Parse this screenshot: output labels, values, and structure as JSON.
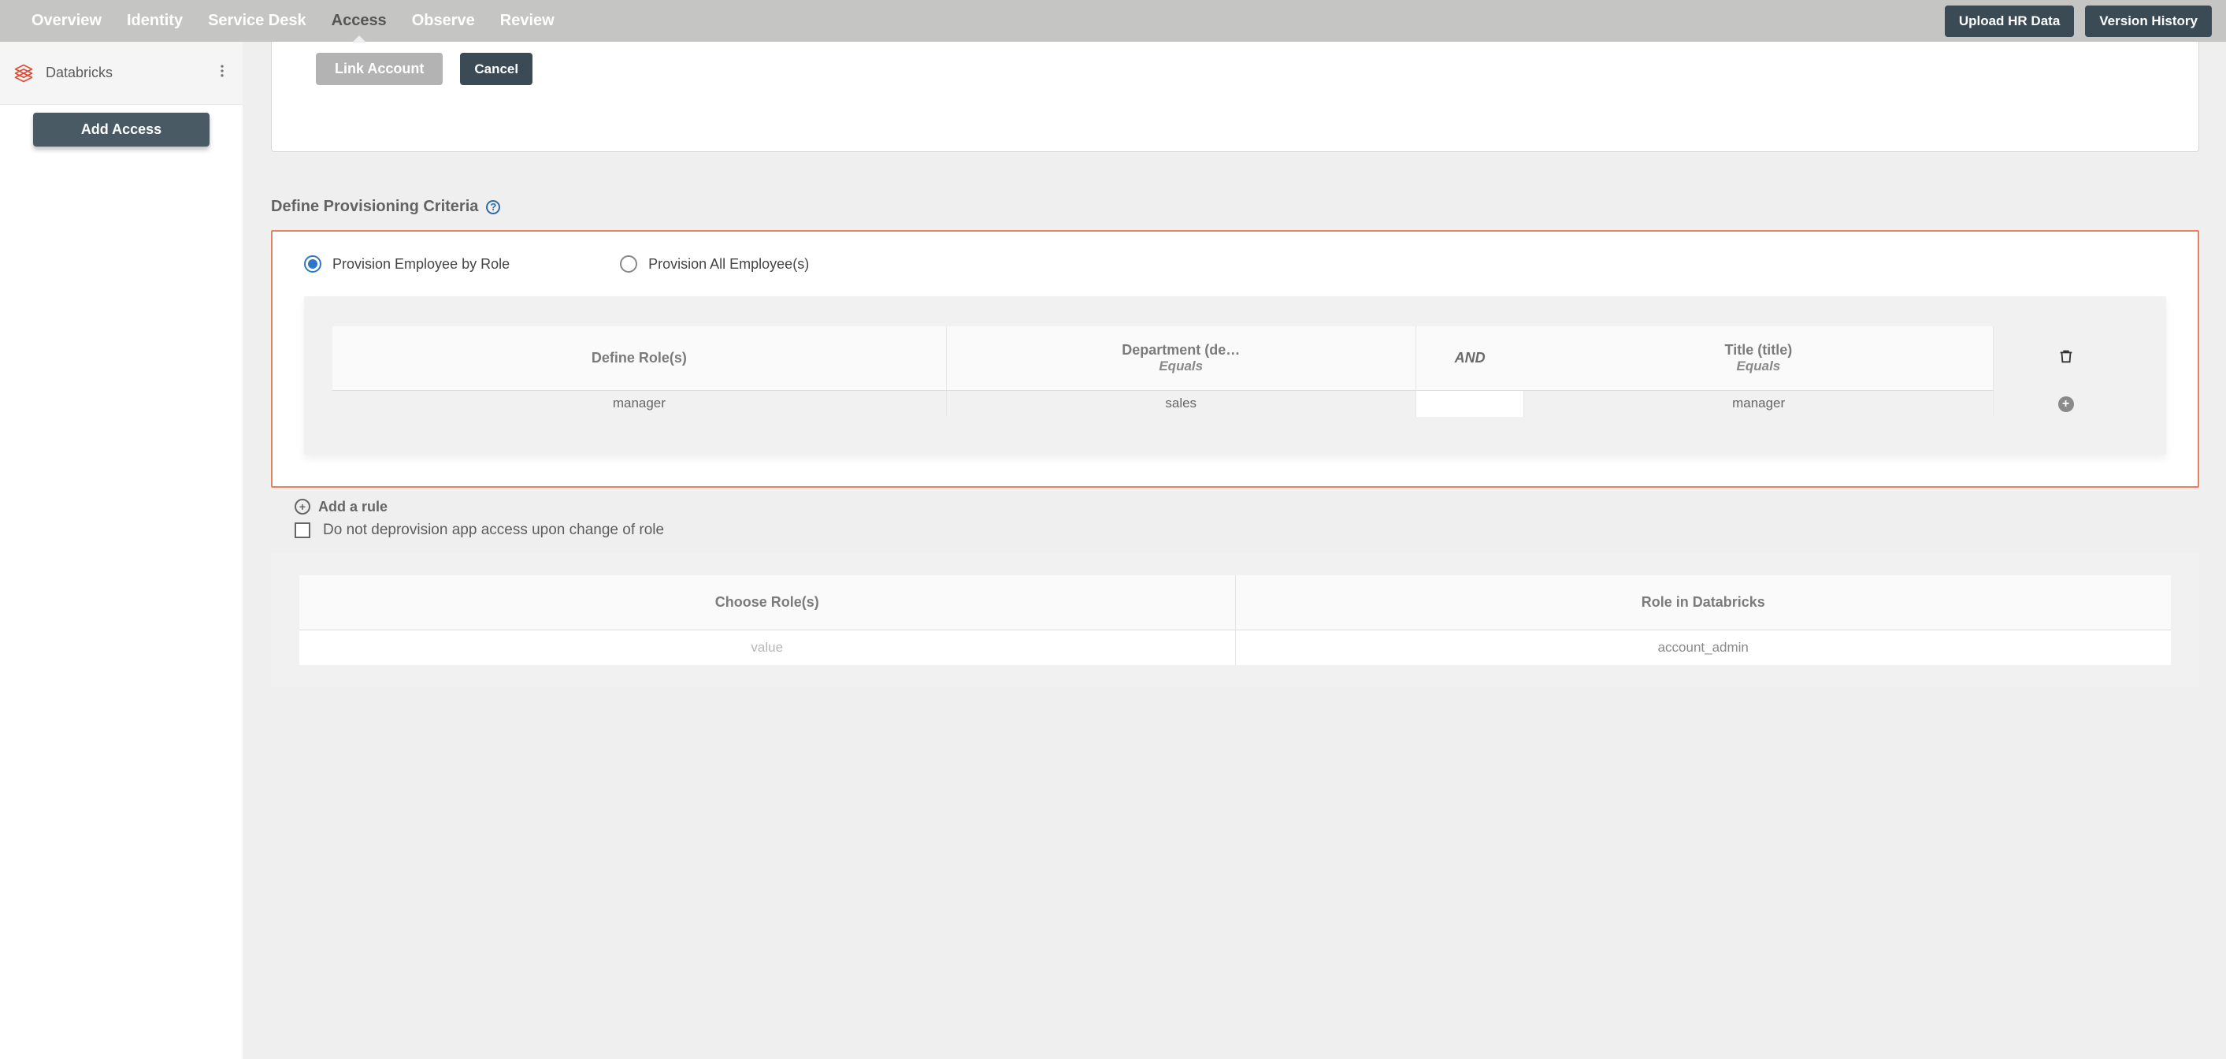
{
  "topnav": {
    "tabs": [
      "Overview",
      "Identity",
      "Service Desk",
      "Access",
      "Observe",
      "Review"
    ],
    "active_index": 3,
    "actions": {
      "upload": "Upload HR Data",
      "history": "Version History"
    }
  },
  "sidebar": {
    "item": {
      "label": "Databricks"
    },
    "add_button": "Add Access"
  },
  "linkbar": {
    "link": "Link Account",
    "cancel": "Cancel"
  },
  "criteria": {
    "title": "Define Provisioning Criteria",
    "options": {
      "by_role": "Provision Employee by Role",
      "all": "Provision All Employee(s)"
    },
    "selected": "by_role",
    "table": {
      "headers": {
        "define": "Define Role(s)",
        "dept_label": "Department (de…",
        "dept_op": "Equals",
        "and": "AND",
        "title_label": "Title (title)",
        "title_op": "Equals"
      },
      "row": {
        "role": "manager",
        "dept": "sales",
        "and": "",
        "title_val": "manager"
      }
    },
    "add_rule": "Add a rule",
    "checkbox_label": "Do not deprovision app access upon change of role"
  },
  "mapping": {
    "headers": {
      "choose": "Choose Role(s)",
      "role_in_app": "Role in Databricks"
    },
    "row": {
      "placeholder": "value",
      "role_value": "account_admin"
    }
  }
}
